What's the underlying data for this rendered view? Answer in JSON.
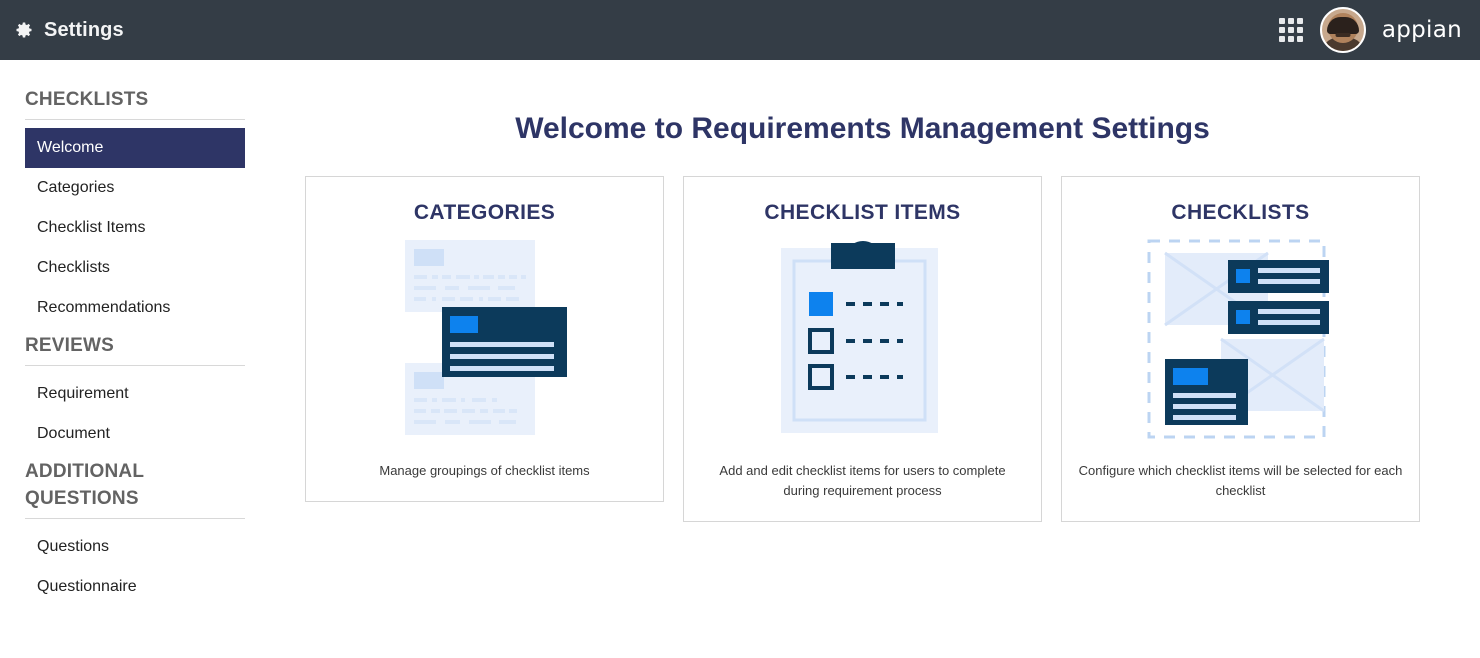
{
  "topbar": {
    "gear_icon": "gear-icon",
    "title": "Settings",
    "grid_icon": "grid-apps-icon",
    "avatar": "user-avatar",
    "brand": "appian",
    "bg_color": "#343d46"
  },
  "sidebar": {
    "sections": [
      {
        "heading": "CHECKLISTS",
        "items": [
          {
            "label": "Welcome",
            "active": true
          },
          {
            "label": "Categories",
            "active": false
          },
          {
            "label": "Checklist Items",
            "active": false
          },
          {
            "label": "Checklists",
            "active": false
          },
          {
            "label": "Recommendations",
            "active": false
          }
        ]
      },
      {
        "heading": "REVIEWS",
        "items": [
          {
            "label": "Requirement",
            "active": false
          },
          {
            "label": "Document",
            "active": false
          }
        ]
      },
      {
        "heading": "ADDITIONAL QUESTIONS",
        "items": [
          {
            "label": "Questions",
            "active": false
          },
          {
            "label": "Questionnaire",
            "active": false
          }
        ]
      }
    ],
    "active_color": "#2e3566"
  },
  "main": {
    "title": "Welcome to Requirements Management Settings",
    "accent_color": "#2e3566",
    "cards": [
      {
        "title": "CATEGORIES",
        "art": "stacked-cards-illustration",
        "description": "Manage groupings of checklist items"
      },
      {
        "title": "CHECKLIST ITEMS",
        "art": "clipboard-checklist-illustration",
        "description": "Add and edit checklist items for users to complete during requirement process"
      },
      {
        "title": "CHECKLISTS",
        "art": "selection-group-illustration",
        "description": "Configure which checklist items will be selected for each checklist"
      }
    ]
  },
  "palette": {
    "dark_navy": "#0c3a5b",
    "bright_blue": "#0d82ee",
    "pale_blue": "#e9f0fb",
    "light_blue": "#cfe0f7"
  }
}
